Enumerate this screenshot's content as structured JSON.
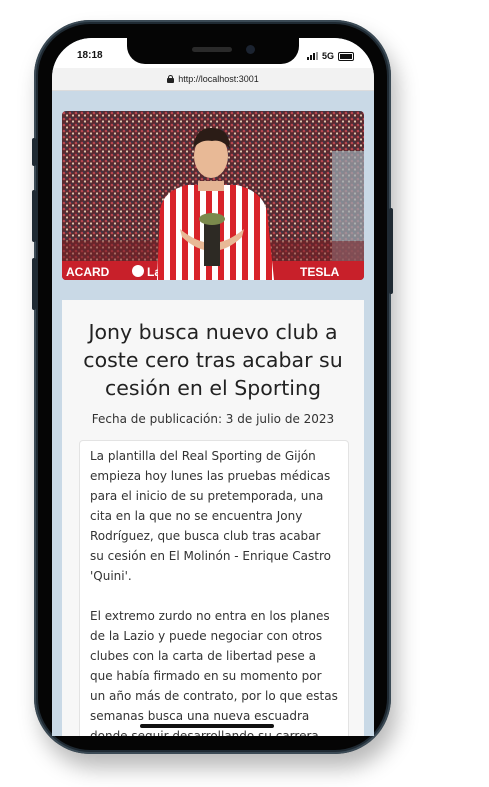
{
  "status_bar": {
    "time": "18:18",
    "network": "5G"
  },
  "browser": {
    "url": "http://localhost:3001"
  },
  "article": {
    "title": "Jony busca nuevo club a coste cero tras acabar su cesión en el Sporting",
    "date": "Fecha de publicación: 3 de julio de 2023",
    "paragraphs": [
      "La plantilla del Real Sporting de Gijón empieza hoy lunes las pruebas médicas para el inicio de su pretemporada, una cita en la que no se encuentra Jony Rodríguez, que busca club tras acabar su cesión en El Molinón - Enrique Castro 'Quini'.",
      "El extremo zurdo no entra en los planes de la Lazio y puede negociar con otros clubes con la carta de libertad pese a que había firmado en su momento por un año más de contrato, por lo que estas semanas busca una nueva escuadra donde seguir desarrollando su carrera."
    ]
  },
  "hero_image": {
    "description_icon": "player-photo",
    "board_text_left": "ACARD",
    "board_text_mid": "LaLiga",
    "board_text_right": "TESLA"
  },
  "colors": {
    "page_background": "#c9d9e6",
    "card_background": "#f7f7f7",
    "jersey_red": "#d8232a"
  }
}
